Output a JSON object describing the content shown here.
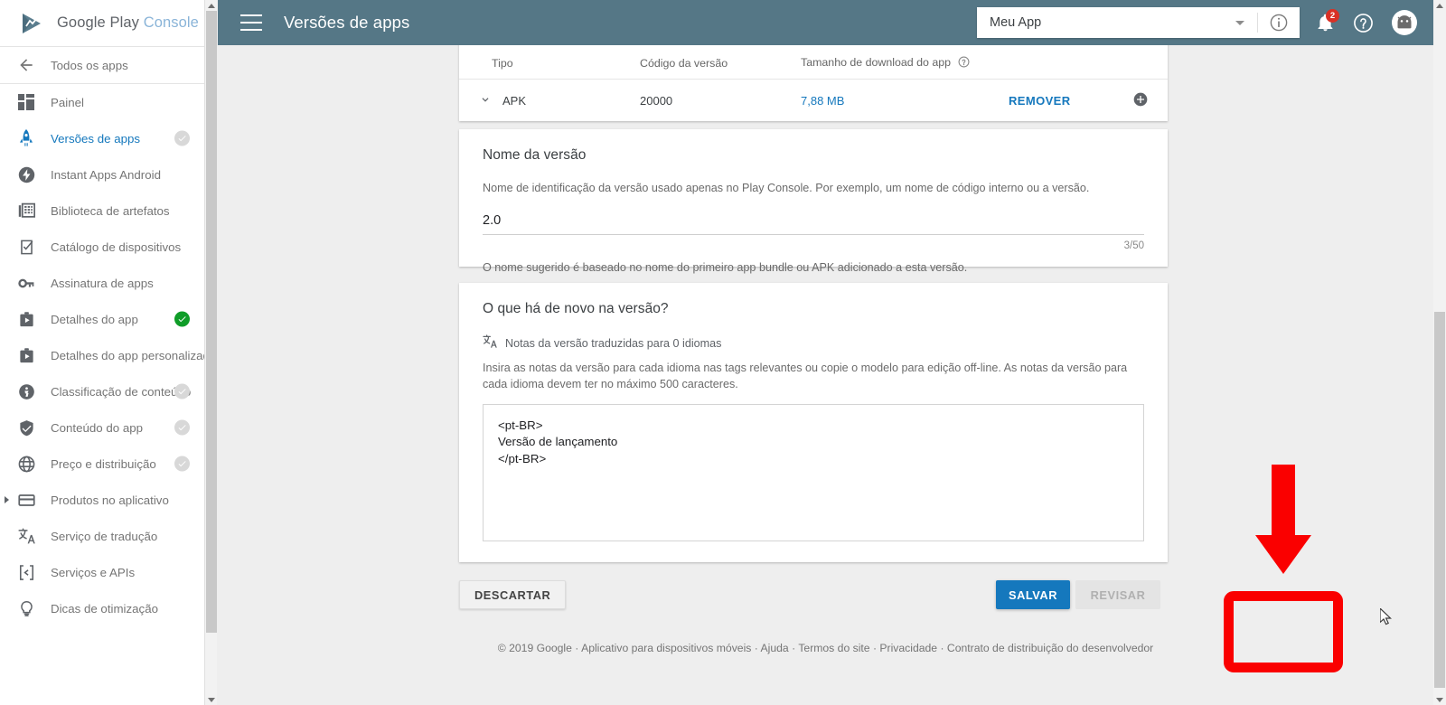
{
  "brand": {
    "logo_text_primary": "Google Play",
    "logo_text_secondary": "Console",
    "logo_icon": "play-console-logo-icon"
  },
  "sidebar": {
    "back_item": {
      "label": "Todos os apps",
      "icon": "arrow-left-icon"
    },
    "items": [
      {
        "label": "Painel",
        "icon": "dashboard-icon",
        "active": false,
        "check": "none"
      },
      {
        "label": "Versões de apps",
        "icon": "rocket-icon",
        "active": true,
        "check": "grey"
      },
      {
        "label": "Instant Apps Android",
        "icon": "instant-apps-icon",
        "active": false,
        "check": "none"
      },
      {
        "label": "Biblioteca de artefatos",
        "icon": "artifact-library-icon",
        "active": false,
        "check": "none"
      },
      {
        "label": "Catálogo de dispositivos",
        "icon": "device-catalog-icon",
        "active": false,
        "check": "none"
      },
      {
        "label": "Assinatura de apps",
        "icon": "key-icon",
        "active": false,
        "check": "none"
      },
      {
        "label": "Detalhes do app",
        "icon": "store-listing-icon",
        "active": false,
        "check": "green"
      },
      {
        "label": "Detalhes do app personalizados",
        "icon": "store-listing-icon",
        "active": false,
        "check": "none"
      },
      {
        "label": "Classificação de conteúdo",
        "icon": "content-rating-icon",
        "active": false,
        "check": "grey"
      },
      {
        "label": "Conteúdo do app",
        "icon": "shield-check-icon",
        "active": false,
        "check": "grey"
      },
      {
        "label": "Preço e distribuição",
        "icon": "globe-icon",
        "active": false,
        "check": "grey"
      },
      {
        "label": "Produtos no aplicativo",
        "icon": "card-icon",
        "active": false,
        "check": "none",
        "expandable": true
      },
      {
        "label": "Serviço de tradução",
        "icon": "translate-icon",
        "active": false,
        "check": "none"
      },
      {
        "label": "Serviços e APIs",
        "icon": "api-icon",
        "active": false,
        "check": "none"
      },
      {
        "label": "Dicas de otimização",
        "icon": "lightbulb-icon",
        "active": false,
        "check": "none"
      }
    ]
  },
  "topbar": {
    "menu_icon": "hamburger-menu-icon",
    "title": "Versões de apps",
    "app_selector_value": "Meu App",
    "app_selector_caret_icon": "chevron-down-icon",
    "info_icon": "info-circle-icon",
    "notifications_icon": "bell-icon",
    "notifications_count": "2",
    "help_icon": "help-circle-icon",
    "avatar_icon": "android-avatar-icon"
  },
  "apk_table": {
    "headers": [
      "Tipo",
      "Código da versão",
      "Tamanho de download do app"
    ],
    "header_help_icon": "help-circle-icon",
    "rows": [
      {
        "expand_icon": "chevron-down-icon",
        "type": "APK",
        "version_code": "20000",
        "download_size": "7,88 MB",
        "action": "REMOVER",
        "add_icon": "plus-circle-icon"
      }
    ]
  },
  "version_name_card": {
    "title": "Nome da versão",
    "description": "Nome de identificação da versão usado apenas no Play Console. Por exemplo, um nome de código interno ou a versão.",
    "value": "2.0",
    "counter": "3/50",
    "hint": "O nome sugerido é baseado no nome do primeiro app bundle ou APK adicionado a esta versão."
  },
  "whats_new_card": {
    "title": "O que há de novo na versão?",
    "translate_icon": "translate-icon",
    "translate_status": "Notas da versão traduzidas para 0 idiomas",
    "description": "Insira as notas da versão para cada idioma nas tags relevantes ou copie o modelo para edição off-line. As notas da versão para cada idioma devem ter no máximo 500 caracteres.",
    "notes_value": "<pt-BR>\nVersão de lançamento\n</pt-BR>"
  },
  "actions": {
    "discard_label": "DESCARTAR",
    "save_label": "SALVAR",
    "review_label": "REVISAR"
  },
  "footer": {
    "text": "© 2019 Google · Aplicativo para dispositivos móveis · Ajuda · Termos do site · Privacidade · Contrato de distribuição do desenvolvedor"
  },
  "annotations": {
    "arrow_icon": "red-down-arrow-annotation",
    "highlight_box": "red-highlight-rectangle-annotation",
    "arrow_color": "#fa0000",
    "highlight_color": "#fa0000"
  },
  "colors": {
    "topbar_bg": "#557786",
    "accent_blue": "#1578bd",
    "page_bg": "#eeeeee",
    "check_green": "#0f9d28",
    "badge_red": "#d93025"
  },
  "cursor": {
    "icon": "mouse-pointer-icon"
  }
}
